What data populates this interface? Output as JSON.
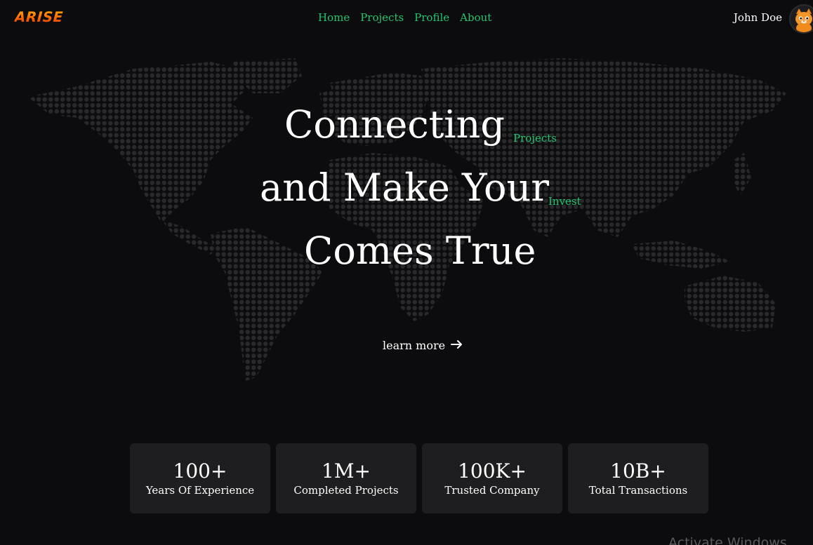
{
  "header": {
    "logo": "ARISE",
    "nav": [
      "Home",
      "Projects",
      "Profile",
      "About"
    ],
    "user_name": "John Doe"
  },
  "hero": {
    "line1": "Connecting",
    "line2": "and Make Your",
    "line3": "Comes True",
    "tag1": "Projects",
    "tag2": "Invest",
    "cta": "learn more"
  },
  "stats": [
    {
      "value": "100+",
      "label": "Years Of Experience"
    },
    {
      "value": "1M+",
      "label": "Completed Projects"
    },
    {
      "value": "100K+",
      "label": "Trusted Company"
    },
    {
      "value": "10B+",
      "label": "Total Transactions"
    }
  ],
  "os_watermark": "Activate Windows",
  "colors": {
    "background": "#0c0c0e",
    "accent": "#22c570",
    "card": "#1e1e20",
    "map_dot": "#2a2a2c"
  },
  "icons": {
    "avatar": "cat-avatar-icon",
    "cta": "arrow-right-icon"
  }
}
